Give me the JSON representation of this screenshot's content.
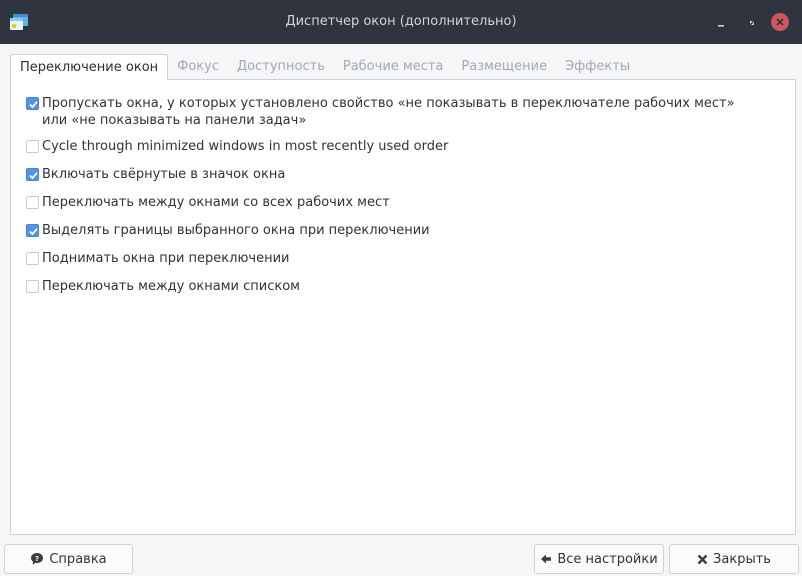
{
  "window": {
    "title": "Диспетчер окон (дополнительно)"
  },
  "tabs": [
    {
      "label": "Переключение окон",
      "active": true
    },
    {
      "label": "Фокус",
      "active": false
    },
    {
      "label": "Доступность",
      "active": false
    },
    {
      "label": "Рабочие места",
      "active": false
    },
    {
      "label": "Размещение",
      "active": false
    },
    {
      "label": "Эффекты",
      "active": false
    }
  ],
  "options": [
    {
      "line1": "Пропускать окна, у которых установлено свойство «не показывать в переключателе рабочих мест»",
      "line2": "или «не показывать на панели задач»",
      "checked": true
    },
    {
      "line1": "Cycle through minimized windows in most recently used order",
      "checked": false
    },
    {
      "line1": "Включать свёрнутые в значок окна",
      "checked": true
    },
    {
      "line1": "Переключать между окнами со всех рабочих мест",
      "checked": false
    },
    {
      "line1": "Выделять границы выбранного окна при переключении",
      "checked": true
    },
    {
      "line1": "Поднимать окна при переключении",
      "checked": false
    },
    {
      "line1": "Переключать между окнами списком",
      "checked": false
    }
  ],
  "buttons": {
    "help": "Справка",
    "all_settings": "Все настройки",
    "close": "Закрыть"
  },
  "colors": {
    "titlebar": "#2f343f",
    "accent": "#5294e2",
    "close": "#cc575d"
  }
}
